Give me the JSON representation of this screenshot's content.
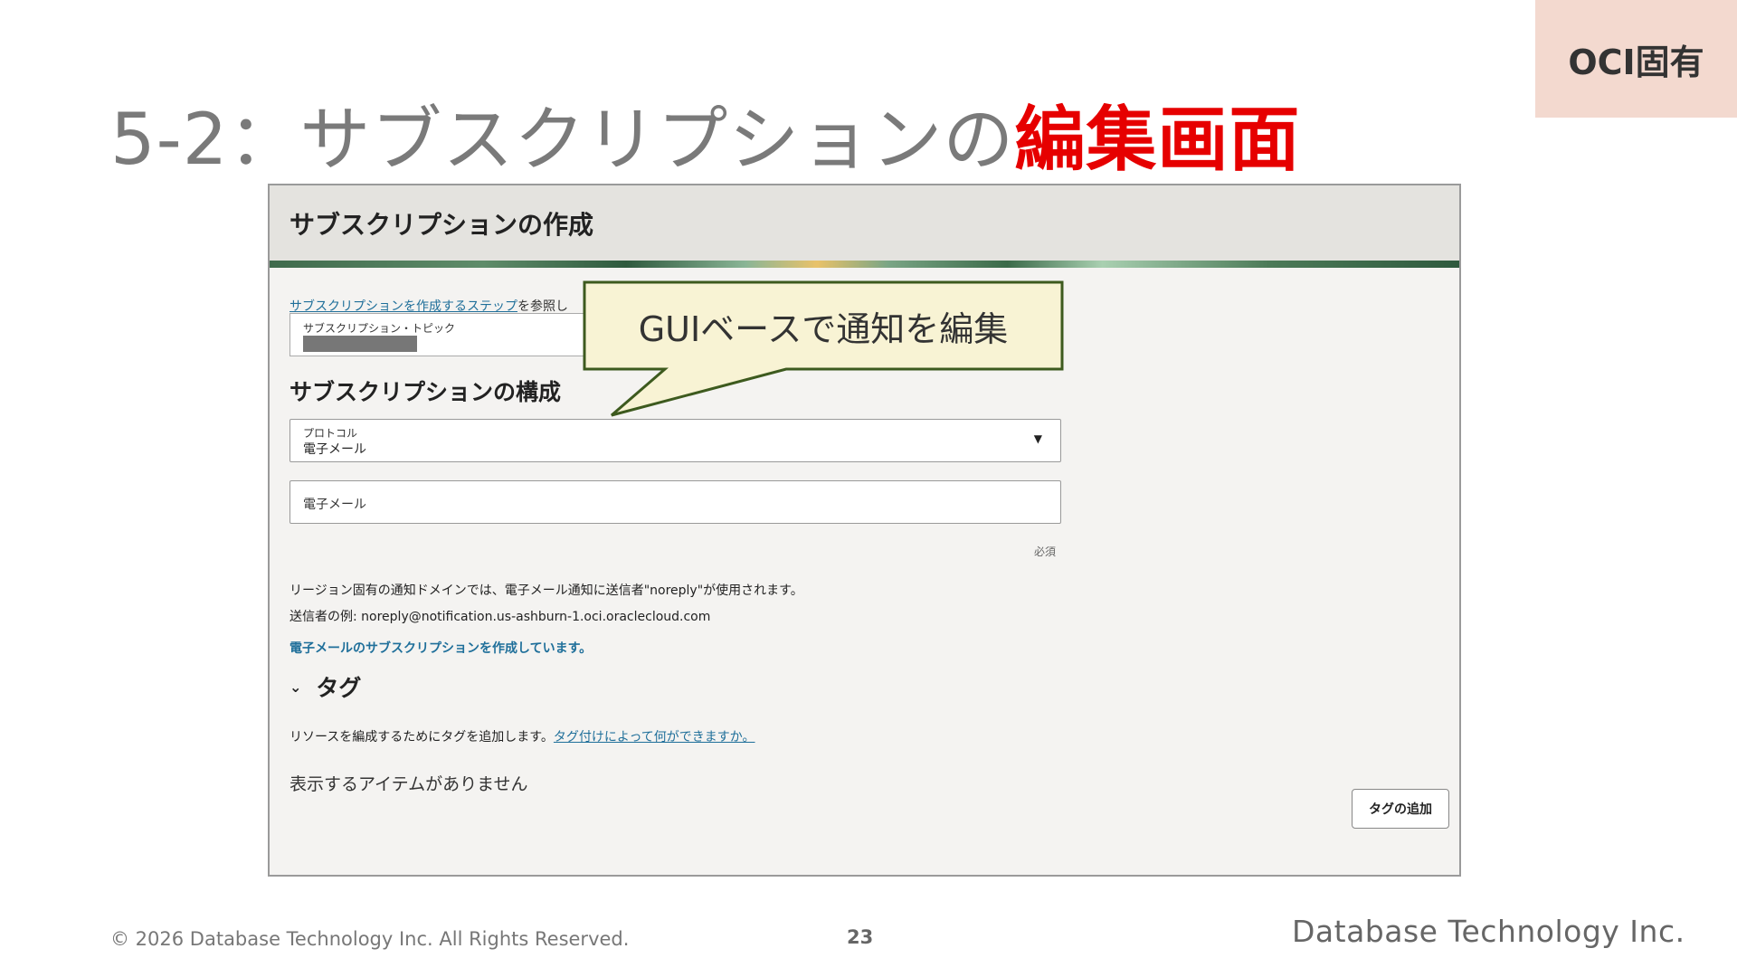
{
  "badge": "OCI固有",
  "slide_title": {
    "prefix": "5-2：サブスクリプションの",
    "highlight": "編集画面"
  },
  "dialog": {
    "title": "サブスクリプションの作成",
    "steps_link": "サブスクリプションを作成するステップ",
    "steps_suffix": "を参照し",
    "topic_label": "サブスクリプション・トピック",
    "config_heading": "サブスクリプションの構成",
    "protocol_label": "プロトコル",
    "protocol_value": "電子メール",
    "email_placeholder": "電子メール",
    "required_label": "必須",
    "note1": "リージョン固有の通知ドメインでは、電子メール通知に送信者\"noreply\"が使用されます。",
    "note2": "送信者の例: noreply@notification.us-ashburn-1.oci.oraclecloud.com",
    "info_link": "電子メールのサブスクリプションを作成しています。",
    "tags_heading": "タグ",
    "tags_desc": "リソースを編成するためにタグを追加します。",
    "tags_link": "タグ付けによって何ができますか。",
    "empty_text": "表示するアイテムがありません",
    "add_tag_button": "タグの追加"
  },
  "callout_text": "GUIベースで通知を編集",
  "footer": {
    "copyright": "© 2026 Database Technology Inc. All Rights Reserved.",
    "page_number": "23",
    "company": "Database Technology Inc."
  },
  "colors": {
    "accent_red": "#e60000",
    "badge_bg": "#f3d9cf",
    "callout_bg": "#f8f3d4",
    "callout_border": "#3d5a1e",
    "link_blue": "#1f6f9a"
  }
}
